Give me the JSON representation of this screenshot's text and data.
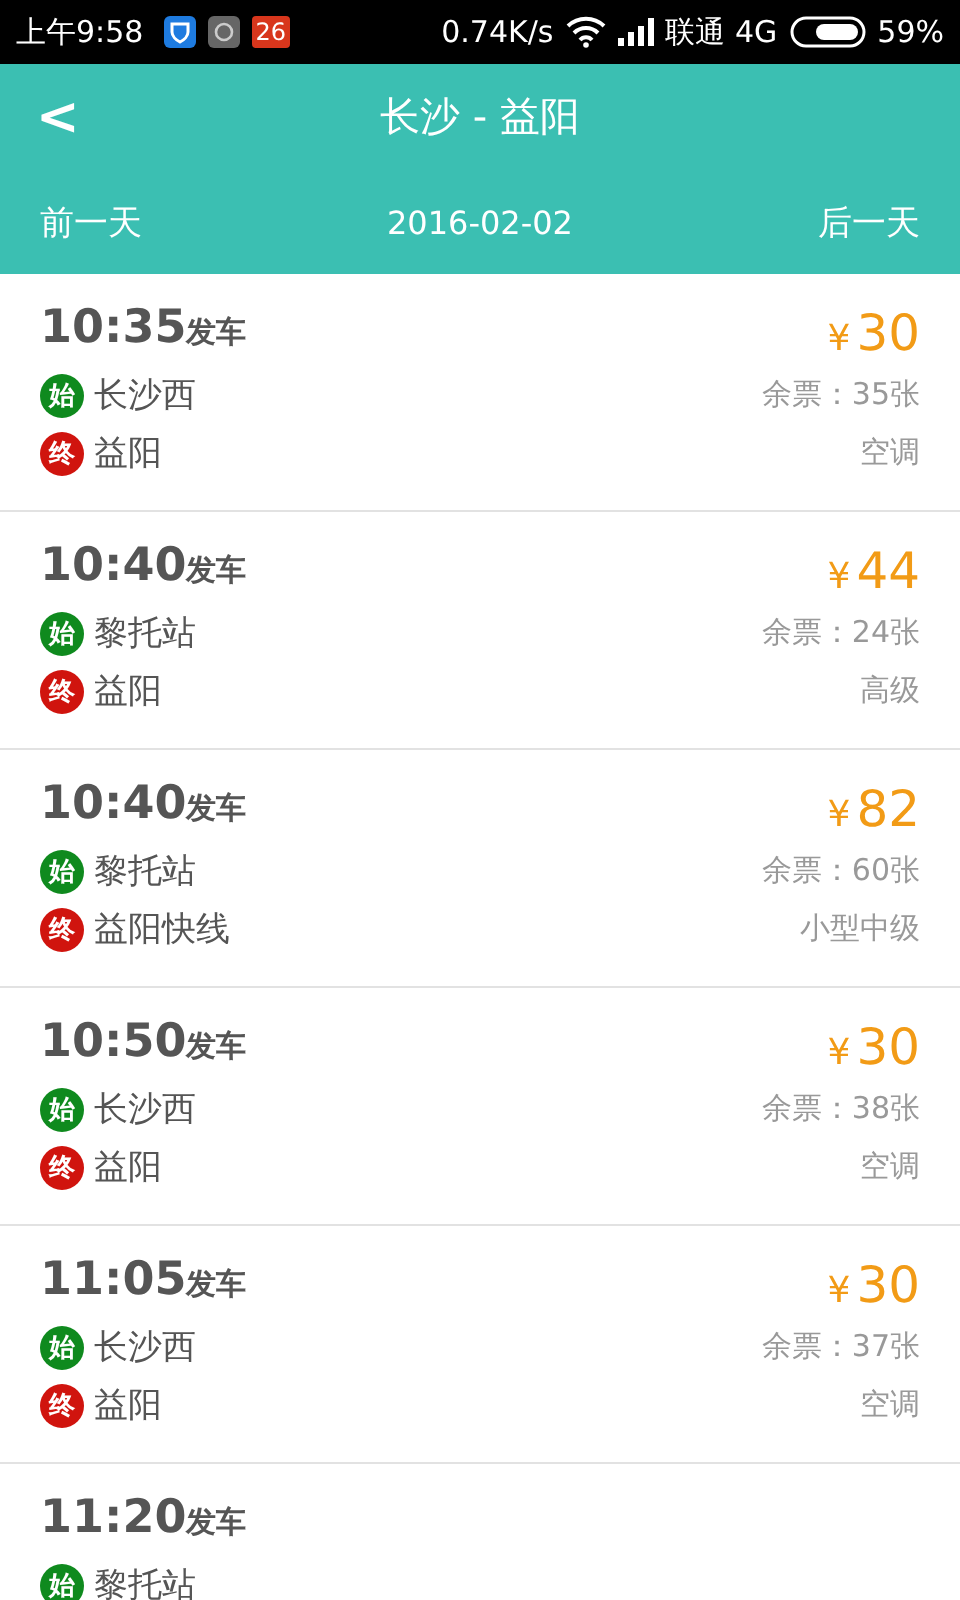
{
  "status_bar": {
    "time": "上午9:58",
    "notification_badge": "26",
    "speed": "0.74K/s",
    "carrier": "联通 4G",
    "battery": "59%"
  },
  "header": {
    "back": "<",
    "title": "长沙 - 益阳",
    "prev_day": "前一天",
    "date": "2016-02-02",
    "next_day": "后一天"
  },
  "trips": [
    {
      "time": "10:35",
      "suffix": "发车",
      "stops": [
        {
          "kind": "start",
          "badge": "始",
          "name": "长沙西"
        },
        {
          "kind": "end",
          "badge": "终",
          "name": "益阳"
        }
      ],
      "currency": "¥",
      "price": "30",
      "remaining": "余票：35张",
      "bus_type": "空调"
    },
    {
      "time": "10:40",
      "suffix": "发车",
      "stops": [
        {
          "kind": "start",
          "badge": "始",
          "name": "黎托站"
        },
        {
          "kind": "end",
          "badge": "终",
          "name": "益阳"
        }
      ],
      "currency": "¥",
      "price": "44",
      "remaining": "余票：24张",
      "bus_type": "高级"
    },
    {
      "time": "10:40",
      "suffix": "发车",
      "stops": [
        {
          "kind": "start",
          "badge": "始",
          "name": "黎托站"
        },
        {
          "kind": "end",
          "badge": "终",
          "name": "益阳快线"
        }
      ],
      "currency": "¥",
      "price": "82",
      "remaining": "余票：60张",
      "bus_type": "小型中级"
    },
    {
      "time": "10:50",
      "suffix": "发车",
      "stops": [
        {
          "kind": "start",
          "badge": "始",
          "name": "长沙西"
        },
        {
          "kind": "end",
          "badge": "终",
          "name": "益阳"
        }
      ],
      "currency": "¥",
      "price": "30",
      "remaining": "余票：38张",
      "bus_type": "空调"
    },
    {
      "time": "11:05",
      "suffix": "发车",
      "stops": [
        {
          "kind": "start",
          "badge": "始",
          "name": "长沙西"
        },
        {
          "kind": "end",
          "badge": "终",
          "name": "益阳"
        }
      ],
      "currency": "¥",
      "price": "30",
      "remaining": "余票：37张",
      "bus_type": "空调"
    },
    {
      "time": "11:20",
      "suffix": "发车",
      "stops": [
        {
          "kind": "start",
          "badge": "始",
          "name": "黎托站"
        }
      ]
    }
  ]
}
